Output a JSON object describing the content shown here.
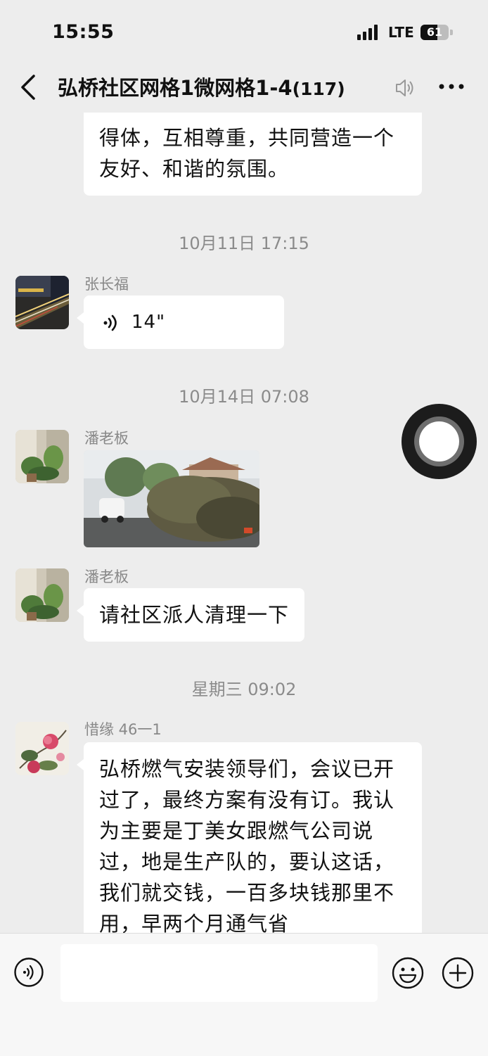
{
  "status_bar": {
    "time": "15:55",
    "network": "LTE",
    "battery": "61",
    "battery_level": 0.61
  },
  "nav": {
    "title": "弘桥社区网格1微网格1-4",
    "member_count": "(117)"
  },
  "chat": {
    "partial_message_text": "得体，互相尊重，共同营造一个友好、和谐的氛围。",
    "timestamps": [
      "10月11日 17:15",
      "10月14日 07:08",
      "星期三 09:02"
    ],
    "messages": [
      {
        "sender": "张长福",
        "voice_duration": "14\""
      },
      {
        "sender": "潘老板"
      },
      {
        "sender": "潘老板",
        "text": "请社区派人清理一下"
      },
      {
        "sender": "惜缘 46一1",
        "text": "弘桥燃气安装领导们，会议已开过了，最终方案有没有订。我认为主要是丁美女跟燃气公司说过，地是生产队的，要认这话，我们就交钱，一百多块钱那里不用，早两个月通气省"
      }
    ]
  },
  "input_bar": {
    "placeholder": ""
  },
  "colors": {
    "background": "#ededed",
    "bubble": "#ffffff",
    "timestamp": "#8b8b8b",
    "sender": "#888888"
  },
  "icons": {
    "back": "chevron-left-icon",
    "mute": "speaker-icon",
    "more": "ellipsis-icon",
    "voice": "voice-wave-icon",
    "emoji": "smiley-icon",
    "plus": "plus-circle-icon"
  }
}
